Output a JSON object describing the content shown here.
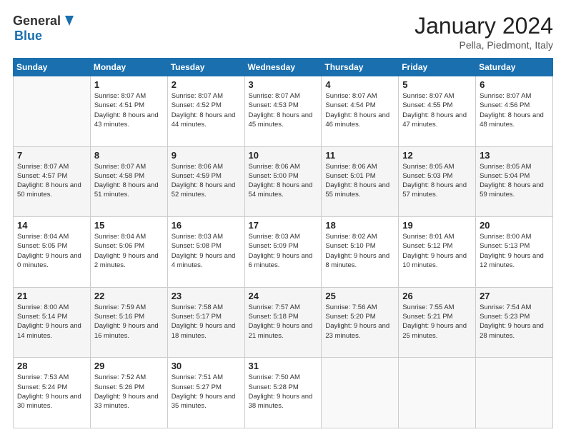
{
  "header": {
    "logo_general": "General",
    "logo_blue": "Blue",
    "title": "January 2024",
    "subtitle": "Pella, Piedmont, Italy"
  },
  "weekdays": [
    "Sunday",
    "Monday",
    "Tuesday",
    "Wednesday",
    "Thursday",
    "Friday",
    "Saturday"
  ],
  "weeks": [
    [
      {
        "day": "",
        "sunrise": "",
        "sunset": "",
        "daylight": "",
        "empty": true
      },
      {
        "day": "1",
        "sunrise": "Sunrise: 8:07 AM",
        "sunset": "Sunset: 4:51 PM",
        "daylight": "Daylight: 8 hours and 43 minutes."
      },
      {
        "day": "2",
        "sunrise": "Sunrise: 8:07 AM",
        "sunset": "Sunset: 4:52 PM",
        "daylight": "Daylight: 8 hours and 44 minutes."
      },
      {
        "day": "3",
        "sunrise": "Sunrise: 8:07 AM",
        "sunset": "Sunset: 4:53 PM",
        "daylight": "Daylight: 8 hours and 45 minutes."
      },
      {
        "day": "4",
        "sunrise": "Sunrise: 8:07 AM",
        "sunset": "Sunset: 4:54 PM",
        "daylight": "Daylight: 8 hours and 46 minutes."
      },
      {
        "day": "5",
        "sunrise": "Sunrise: 8:07 AM",
        "sunset": "Sunset: 4:55 PM",
        "daylight": "Daylight: 8 hours and 47 minutes."
      },
      {
        "day": "6",
        "sunrise": "Sunrise: 8:07 AM",
        "sunset": "Sunset: 4:56 PM",
        "daylight": "Daylight: 8 hours and 48 minutes."
      }
    ],
    [
      {
        "day": "7",
        "sunrise": "Sunrise: 8:07 AM",
        "sunset": "Sunset: 4:57 PM",
        "daylight": "Daylight: 8 hours and 50 minutes."
      },
      {
        "day": "8",
        "sunrise": "Sunrise: 8:07 AM",
        "sunset": "Sunset: 4:58 PM",
        "daylight": "Daylight: 8 hours and 51 minutes."
      },
      {
        "day": "9",
        "sunrise": "Sunrise: 8:06 AM",
        "sunset": "Sunset: 4:59 PM",
        "daylight": "Daylight: 8 hours and 52 minutes."
      },
      {
        "day": "10",
        "sunrise": "Sunrise: 8:06 AM",
        "sunset": "Sunset: 5:00 PM",
        "daylight": "Daylight: 8 hours and 54 minutes."
      },
      {
        "day": "11",
        "sunrise": "Sunrise: 8:06 AM",
        "sunset": "Sunset: 5:01 PM",
        "daylight": "Daylight: 8 hours and 55 minutes."
      },
      {
        "day": "12",
        "sunrise": "Sunrise: 8:05 AM",
        "sunset": "Sunset: 5:03 PM",
        "daylight": "Daylight: 8 hours and 57 minutes."
      },
      {
        "day": "13",
        "sunrise": "Sunrise: 8:05 AM",
        "sunset": "Sunset: 5:04 PM",
        "daylight": "Daylight: 8 hours and 59 minutes."
      }
    ],
    [
      {
        "day": "14",
        "sunrise": "Sunrise: 8:04 AM",
        "sunset": "Sunset: 5:05 PM",
        "daylight": "Daylight: 9 hours and 0 minutes."
      },
      {
        "day": "15",
        "sunrise": "Sunrise: 8:04 AM",
        "sunset": "Sunset: 5:06 PM",
        "daylight": "Daylight: 9 hours and 2 minutes."
      },
      {
        "day": "16",
        "sunrise": "Sunrise: 8:03 AM",
        "sunset": "Sunset: 5:08 PM",
        "daylight": "Daylight: 9 hours and 4 minutes."
      },
      {
        "day": "17",
        "sunrise": "Sunrise: 8:03 AM",
        "sunset": "Sunset: 5:09 PM",
        "daylight": "Daylight: 9 hours and 6 minutes."
      },
      {
        "day": "18",
        "sunrise": "Sunrise: 8:02 AM",
        "sunset": "Sunset: 5:10 PM",
        "daylight": "Daylight: 9 hours and 8 minutes."
      },
      {
        "day": "19",
        "sunrise": "Sunrise: 8:01 AM",
        "sunset": "Sunset: 5:12 PM",
        "daylight": "Daylight: 9 hours and 10 minutes."
      },
      {
        "day": "20",
        "sunrise": "Sunrise: 8:00 AM",
        "sunset": "Sunset: 5:13 PM",
        "daylight": "Daylight: 9 hours and 12 minutes."
      }
    ],
    [
      {
        "day": "21",
        "sunrise": "Sunrise: 8:00 AM",
        "sunset": "Sunset: 5:14 PM",
        "daylight": "Daylight: 9 hours and 14 minutes."
      },
      {
        "day": "22",
        "sunrise": "Sunrise: 7:59 AM",
        "sunset": "Sunset: 5:16 PM",
        "daylight": "Daylight: 9 hours and 16 minutes."
      },
      {
        "day": "23",
        "sunrise": "Sunrise: 7:58 AM",
        "sunset": "Sunset: 5:17 PM",
        "daylight": "Daylight: 9 hours and 18 minutes."
      },
      {
        "day": "24",
        "sunrise": "Sunrise: 7:57 AM",
        "sunset": "Sunset: 5:18 PM",
        "daylight": "Daylight: 9 hours and 21 minutes."
      },
      {
        "day": "25",
        "sunrise": "Sunrise: 7:56 AM",
        "sunset": "Sunset: 5:20 PM",
        "daylight": "Daylight: 9 hours and 23 minutes."
      },
      {
        "day": "26",
        "sunrise": "Sunrise: 7:55 AM",
        "sunset": "Sunset: 5:21 PM",
        "daylight": "Daylight: 9 hours and 25 minutes."
      },
      {
        "day": "27",
        "sunrise": "Sunrise: 7:54 AM",
        "sunset": "Sunset: 5:23 PM",
        "daylight": "Daylight: 9 hours and 28 minutes."
      }
    ],
    [
      {
        "day": "28",
        "sunrise": "Sunrise: 7:53 AM",
        "sunset": "Sunset: 5:24 PM",
        "daylight": "Daylight: 9 hours and 30 minutes."
      },
      {
        "day": "29",
        "sunrise": "Sunrise: 7:52 AM",
        "sunset": "Sunset: 5:26 PM",
        "daylight": "Daylight: 9 hours and 33 minutes."
      },
      {
        "day": "30",
        "sunrise": "Sunrise: 7:51 AM",
        "sunset": "Sunset: 5:27 PM",
        "daylight": "Daylight: 9 hours and 35 minutes."
      },
      {
        "day": "31",
        "sunrise": "Sunrise: 7:50 AM",
        "sunset": "Sunset: 5:28 PM",
        "daylight": "Daylight: 9 hours and 38 minutes."
      },
      {
        "day": "",
        "empty": true
      },
      {
        "day": "",
        "empty": true
      },
      {
        "day": "",
        "empty": true
      }
    ]
  ]
}
